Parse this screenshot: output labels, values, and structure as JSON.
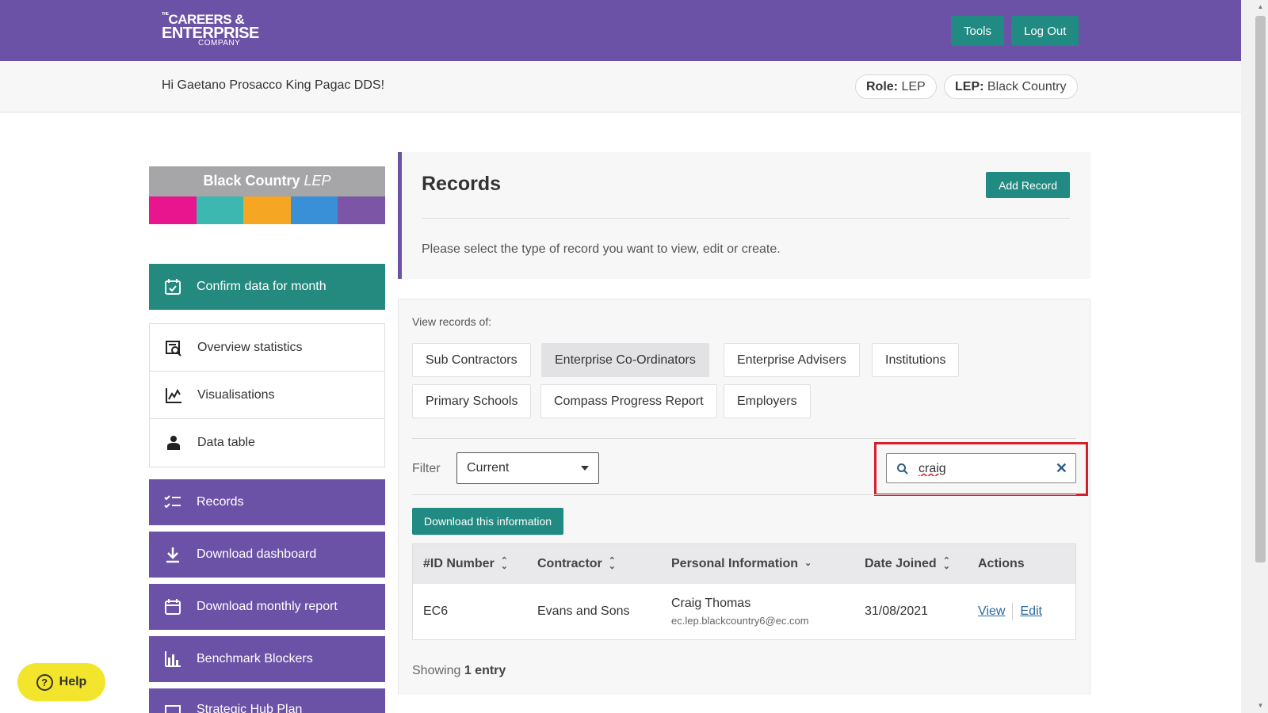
{
  "header": {
    "logo": {
      "line1": "CAREERS &",
      "line2": "ENTERPRISE",
      "line3": "COMPANY",
      "the": "THE"
    },
    "tools_label": "Tools",
    "logout_label": "Log Out",
    "brand_color": "#6b52a6",
    "accent_color": "#218a82"
  },
  "subheader": {
    "greeting": "Hi Gaetano Prosacco King Pagac DDS!",
    "role_label": "Role:",
    "role_value": "LEP",
    "lep_label": "LEP:",
    "lep_value": "Black Country"
  },
  "sidebar": {
    "lep_logo": {
      "title": "Black Country",
      "suffix": "LEP",
      "stripes": [
        "#e8158e",
        "#3cb8b0",
        "#f5a623",
        "#3a90d6",
        "#7d55a6"
      ]
    },
    "confirm": {
      "label": "Confirm data for month",
      "icon": "calendar-check-icon"
    },
    "group": [
      {
        "label": "Overview statistics",
        "icon": "search-document-icon"
      },
      {
        "label": "Visualisations",
        "icon": "chart-line-icon"
      },
      {
        "label": "Data table",
        "icon": "person-icon"
      }
    ],
    "purple": [
      {
        "label": "Records",
        "icon": "checklist-icon"
      },
      {
        "label": "Download dashboard",
        "icon": "download-icon"
      },
      {
        "label": "Download monthly report",
        "icon": "calendar-icon"
      },
      {
        "label": "Benchmark Blockers",
        "icon": "bar-chart-icon"
      },
      {
        "label": "Strategic Hub Plan",
        "icon": "folder-icon"
      }
    ]
  },
  "records": {
    "title": "Records",
    "add_label": "Add Record",
    "description": "Please select the type of record you want to view, edit or create."
  },
  "panel": {
    "view_label": "View records of:",
    "types_row1": [
      "Sub Contractors",
      "Enterprise Co-Ordinators",
      "Enterprise Advisers",
      "Institutions"
    ],
    "types_row2": [
      "Primary Schools",
      "Compass Progress Report",
      "Employers"
    ],
    "active_type": "Enterprise Co-Ordinators",
    "filter_label": "Filter",
    "filter_value": "Current",
    "search_value": "craig",
    "clear_icon": "close-icon",
    "download_label": "Download this information"
  },
  "table": {
    "headers": [
      "#ID Number",
      "Contractor",
      "Personal Information",
      "Date Joined",
      "Actions"
    ],
    "rows": [
      {
        "id": "EC6",
        "contractor": "Evans and Sons",
        "name": "Craig Thomas",
        "email": "ec.lep.blackcountry6@ec.com",
        "date": "31/08/2021",
        "view": "View",
        "edit": "Edit"
      }
    ],
    "showing_prefix": "Showing",
    "showing_count": "1 entry"
  },
  "help": {
    "label": "Help"
  }
}
